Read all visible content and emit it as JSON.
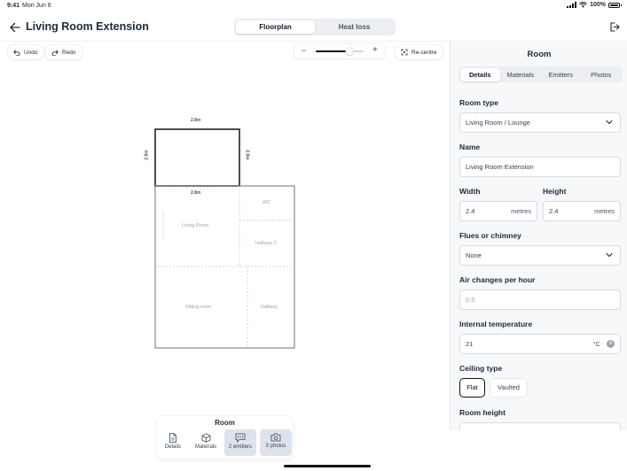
{
  "status": {
    "time": "9:41",
    "date": "Mon Jun 6",
    "battery": "100%"
  },
  "header": {
    "title": "Living Room Extension",
    "view_tabs": [
      {
        "label": "Floorplan",
        "active": true
      },
      {
        "label": "Heat loss",
        "active": false
      }
    ]
  },
  "toolbar": {
    "undo": "Undo",
    "redo": "Redo",
    "zoom_minus": "−",
    "zoom_plus": "+",
    "zoom_level": 0.7,
    "recentre": "Re-centre"
  },
  "floorplan": {
    "dims": {
      "top": "2.8m",
      "left": "2.8m",
      "right": "2.8m",
      "inner": "2.8m"
    },
    "rooms": {
      "living": "Living Room",
      "wc": "WC",
      "hallway2": "Hallway 2",
      "sitting": "Sitting room",
      "hallway": "Hallway"
    }
  },
  "dock": {
    "title": "Room",
    "items": [
      {
        "label": "Details",
        "icon": "document-icon",
        "active": false
      },
      {
        "label": "Materials",
        "icon": "cube-icon",
        "active": false
      },
      {
        "label": "2 emitters",
        "icon": "emitter-icon",
        "active": true
      },
      {
        "label": "3 photos",
        "icon": "camera-icon",
        "active": true
      }
    ]
  },
  "panel": {
    "title": "Room",
    "tabs": [
      {
        "label": "Details",
        "active": true
      },
      {
        "label": "Materials",
        "active": false
      },
      {
        "label": "Emitters",
        "active": false
      },
      {
        "label": "Photos",
        "active": false
      }
    ],
    "room_type": {
      "label": "Room type",
      "value": "Living Room / Lounge"
    },
    "name": {
      "label": "Name",
      "value": "Living Room Extension"
    },
    "width": {
      "label": "Width",
      "value": "2.4",
      "unit": "metres"
    },
    "height": {
      "label": "Height",
      "value": "2.4",
      "unit": "metres"
    },
    "flues": {
      "label": "Flues or chimney",
      "value": "None"
    },
    "air_changes": {
      "label": "Air changes per hour",
      "placeholder": "0.5"
    },
    "internal_temp": {
      "label": "Internal temperature",
      "value": "21",
      "unit": "°C"
    },
    "ceiling_type": {
      "label": "Ceiling type",
      "options": [
        {
          "label": "Flat",
          "active": true
        },
        {
          "label": "Vaulted",
          "active": false
        }
      ]
    },
    "room_height": {
      "label": "Room height"
    }
  },
  "colors": {
    "accent": "#111111",
    "dock_active": "#dde3ec",
    "wall": "#2b2b2b",
    "muted_wall": "#9aa3ad"
  }
}
